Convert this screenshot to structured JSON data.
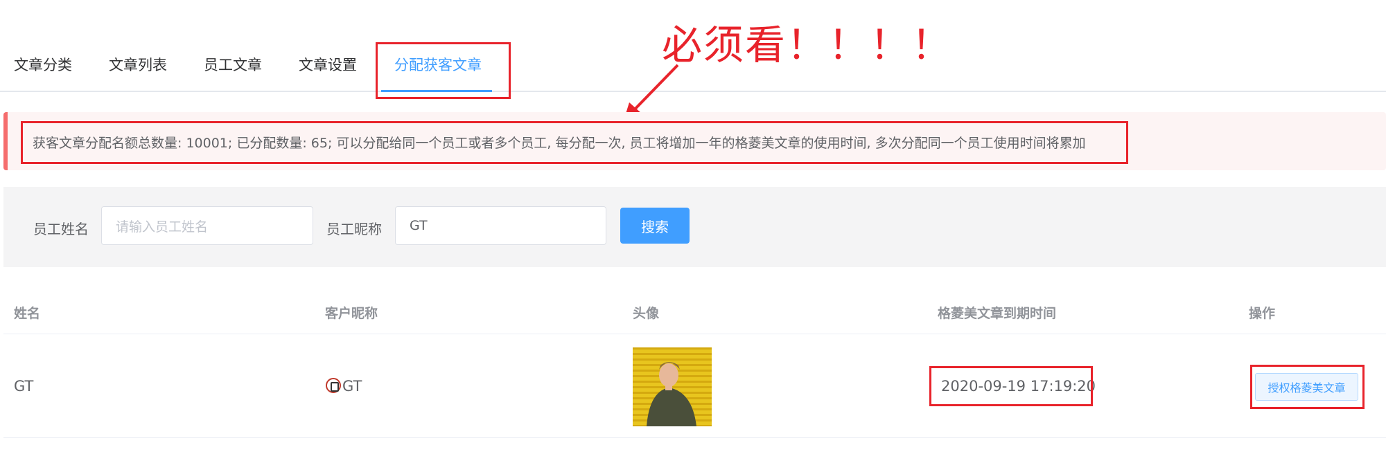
{
  "tabs": [
    {
      "label": "文章分类"
    },
    {
      "label": "文章列表"
    },
    {
      "label": "员工文章"
    },
    {
      "label": "文章设置"
    },
    {
      "label": "分配获客文章",
      "active": true
    }
  ],
  "annotation": {
    "text": "必须看！！！！"
  },
  "alert": {
    "text": "获客文章分配名额总数量: 10001; 已分配数量: 65; 可以分配给同一个员工或者多个员工, 每分配一次, 员工将增加一年的格菱美文章的使用时间, 多次分配同一个员工使用时间将累加"
  },
  "search": {
    "name_label": "员工姓名",
    "name_placeholder": "请输入员工姓名",
    "name_value": "",
    "nickname_label": "员工昵称",
    "nickname_value": "GT",
    "button_label": "搜索"
  },
  "table": {
    "headers": [
      "姓名",
      "客户昵称",
      "头像",
      "格菱美文章到期时间",
      "操作"
    ],
    "rows": [
      {
        "name": "GT",
        "nickname": "GT",
        "expire": "2020-09-19 17:19:20",
        "action": "授权格菱美文章"
      }
    ]
  },
  "colors": {
    "accent": "#409eff",
    "annotation": "#e8232b",
    "alert_border": "#f56c6c"
  }
}
